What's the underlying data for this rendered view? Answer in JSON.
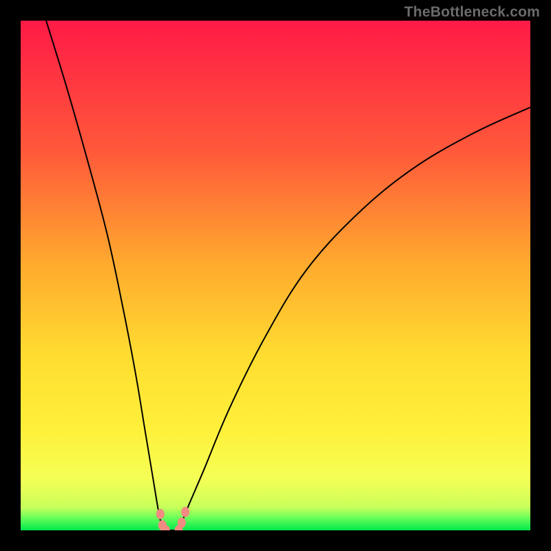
{
  "watermark": "TheBottleneck.com",
  "chart_data": {
    "type": "line",
    "title": "",
    "xlabel": "",
    "ylabel": "",
    "xlim": [
      0,
      100
    ],
    "ylim": [
      0,
      100
    ],
    "grid": false,
    "legend": false,
    "background_gradient": [
      "#ff1a46",
      "#ff8a2e",
      "#ffd22d",
      "#fff03a",
      "#f9ff60",
      "#2cff5f",
      "#00e84d"
    ],
    "series": [
      {
        "name": "left-curve",
        "x": [
          5,
          9,
          13,
          17,
          20,
          22.5,
          24.5,
          26,
          27,
          27.6,
          28.0
        ],
        "y": [
          100,
          87,
          73,
          58,
          44,
          31,
          19,
          10,
          4,
          1.2,
          0
        ]
      },
      {
        "name": "right-curve",
        "x": [
          31.0,
          31.6,
          33,
          36,
          41,
          48,
          56,
          66,
          77,
          89,
          100
        ],
        "y": [
          0,
          1.5,
          5,
          12,
          24,
          38,
          51,
          62,
          71,
          78,
          83
        ]
      },
      {
        "name": "valley-floor",
        "x": [
          28.0,
          29.5,
          31.0
        ],
        "y": [
          0,
          0,
          0
        ]
      }
    ],
    "markers": [
      {
        "name": "left-marker-upper",
        "x": 27.4,
        "y": 3.2
      },
      {
        "name": "left-marker-lower",
        "x": 27.8,
        "y": 1.0
      },
      {
        "name": "left-floor-marker",
        "x": 28.5,
        "y": 0.0
      },
      {
        "name": "right-floor-marker",
        "x": 31.0,
        "y": 0.0
      },
      {
        "name": "right-marker-lower",
        "x": 31.6,
        "y": 1.5
      },
      {
        "name": "right-marker-upper",
        "x": 32.3,
        "y": 3.6
      }
    ],
    "marker_color": "#f28b82",
    "line_color": "#000000",
    "line_width": 2,
    "marker_radius": 6
  }
}
